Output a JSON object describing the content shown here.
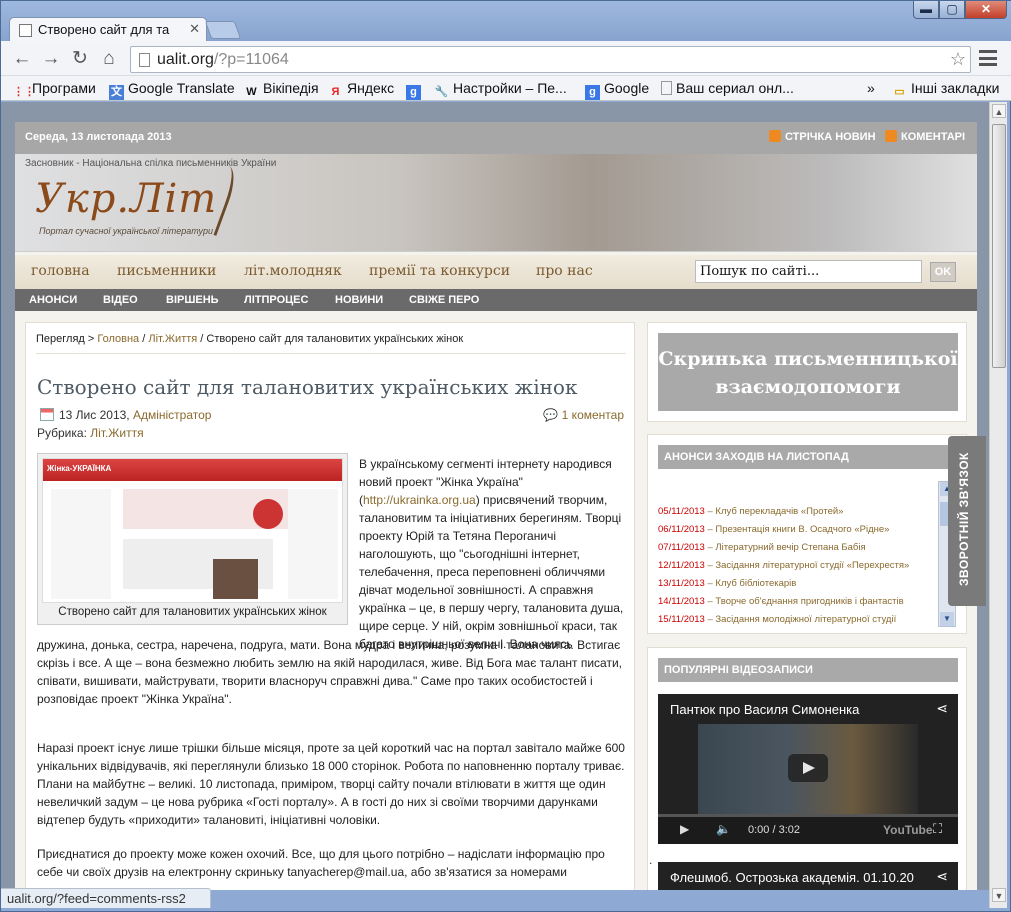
{
  "browser": {
    "tab_title": "Створено сайт для та",
    "url_host": "ualit.org",
    "url_rest": "/?p=11064",
    "window_buttons": {
      "minimize": "▬",
      "maximize": "▢",
      "close": "✕"
    },
    "bookmarks": [
      {
        "label": "Програми",
        "icon": "apps-icon"
      },
      {
        "label": "Google Translate",
        "icon": "translate-icon"
      },
      {
        "label": "Вікіпедія",
        "icon": "wikipedia-icon"
      },
      {
        "label": "Яндекс",
        "icon": "yandex-icon"
      },
      {
        "label": "",
        "icon": "google-icon"
      },
      {
        "label": "Настройки – Пе...",
        "icon": "wrench-icon"
      },
      {
        "label": "Google",
        "icon": "google-icon"
      },
      {
        "label": "Ваш сериал онл...",
        "icon": "page-icon"
      }
    ],
    "bookmarks_overflow": "»",
    "other_bookmarks": "Інші закладки",
    "status_text": "ualit.org/?feed=comments-rss2"
  },
  "site": {
    "date": "Середа, 13 листопада 2013",
    "rss_news": "СТРІЧКА НОВИН",
    "rss_comments": "КОМЕНТАРІ",
    "founder": "Засновник - Національна спілка письменників України",
    "logo": "Укр.Літ",
    "logo_sub": "Портал сучасної української літератури",
    "main_nav": [
      "головна",
      "письменники",
      "літ.молодняк",
      "премії та конкурси",
      "про нас"
    ],
    "search_placeholder": "Пошук по сайті...",
    "search_button": "OK",
    "sub_nav": [
      "АНОНСИ",
      "ВІДЕО",
      "ВІРШЕНЬ",
      "ЛІТПРОЦЕС",
      "НОВИНИ",
      "СВІЖЕ ПЕРО"
    ]
  },
  "article": {
    "breadcrumb": {
      "prefix": "Перегляд >",
      "home": "Головна",
      "sep1": "/",
      "cat": "Літ.Життя",
      "sep2": "/",
      "current": "Створено сайт для талановитих українських жінок"
    },
    "title": "Створено сайт для талановитих українських жінок",
    "date": "13 Лис 2013,",
    "author": "Адміністратор",
    "comments": "1 коментар",
    "rubric_label": "Рубрика:",
    "rubric": "Літ.Життя",
    "figure_caption": "Створено сайт для талановитих українських жінок",
    "figure_site_name": "Жінка-УКРАЇНКА",
    "p1_start": "В українському сегменті інтернету народився новий проект \"Жінка Україна\" (",
    "p1_link": "http://ukrainka.org.ua",
    "p1_rest": ") присвячений творчим, талановитим та ініціативних берегиням. Творці проекту Юрій та Тетяна Пероганичі наголошують, що \"сьогоднішні інтернет, телебачення, преса переповнені обличчями дівчат модельної зовнішності. А справжня українка – це, в першу чергу, талановита душа, щире серце. У ній, окрім зовнішньої краси, так багато внутрішньої величі. Вона чиясь",
    "p1_cont": "дружина, донька, сестра, наречена, подруга, мати. Вона мудра і велична, розумна і талановита. Встигає скрізь і все. А ще – вона безмежно любить землю на якій народилася, живе. Від Бога має талант писати, співати, вишивати, майструвати, творити власноруч справжні дива.\" Саме про таких особистостей і розповідає проект \"Жінка Україна\".",
    "p2": "Наразі проект існує лише трішки більше місяця, проте за цей короткий час на портал завітало майже 600 унікальних відвідувачів, які переглянули близько 18 000 сторінок. Робота по наповненню порталу триває. Плани на майбутнє – великі. 10 листопада, приміром, творці сайту почали втілювати в життя ще один невеличкий задум – це нова рубрика «Гості порталу». А в гості до них зі своїми творчими дарунками відтепер будуть «приходити» талановиті, ініціативні чоловіки.",
    "p3": "Приєднатися до проекту може кожен охочий. Все, що для цього потрібно – надіслати інформацію про себе чи своїх друзів на електронну скриньку tanyacherep@mail.ua, або зв'язатися за номерами"
  },
  "sidebar": {
    "box1": "Скринька письменницької взаємодопомоги",
    "events_title": "АНОНСИ ЗАХОДІВ НА ЛИСТОПАД",
    "events": [
      {
        "date": "05/11/2013",
        "text": "– Клуб перекладачів «Протей»"
      },
      {
        "date": "06/11/2013",
        "text": "– Презентація книги В. Осадчого «Рідне»"
      },
      {
        "date": "07/11/2013",
        "text": "– Літературний вечір Степана Бабія"
      },
      {
        "date": "12/11/2013",
        "text": "– Засідання літературної студії «Перехрестя»"
      },
      {
        "date": "13/11/2013",
        "text": "– Клуб бібліотекарів"
      },
      {
        "date": "14/11/2013",
        "text": "– Творче об'єднання пригодників і фантастів"
      },
      {
        "date": "15/11/2013",
        "text": "– Засідання молодіжної літературної студії"
      }
    ],
    "videos_title": "ПОПУЛЯРНІ ВІДЕОЗАПИСИ",
    "video1_title": "Пантюк про Василя Симоненка",
    "video1_time": "0:00 / 3:02",
    "video1_logo": "YouTube",
    "dot": ".",
    "video2_title": "Флешмоб. Острозька академія. 01.10.20",
    "feedback": "ЗВОРОТНІЙ ЗВ'ЯЗОК"
  }
}
